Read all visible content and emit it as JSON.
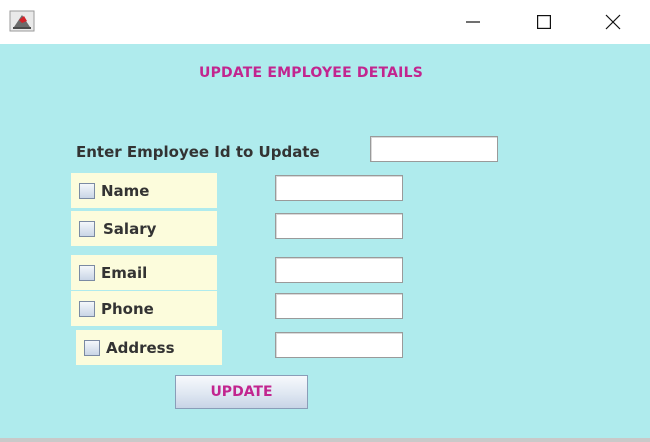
{
  "window": {
    "icon": "java-cup-icon",
    "controls": [
      "minimize-icon",
      "maximize-icon",
      "close-icon"
    ]
  },
  "form": {
    "heading": "UPDATE EMPLOYEE DETAILS",
    "employee_id_label": "Enter Employee Id to Update",
    "employee_id_value": "",
    "fields": [
      {
        "label": "Name",
        "checked": false,
        "value": ""
      },
      {
        "label": "Salary",
        "checked": false,
        "value": ""
      },
      {
        "label": "Email",
        "checked": false,
        "value": ""
      },
      {
        "label": "Phone",
        "checked": false,
        "value": ""
      },
      {
        "label": "Address",
        "checked": false,
        "value": ""
      }
    ],
    "submit_label": "UPDATE"
  },
  "colors": {
    "background": "#afebed",
    "accent_text": "#c2258f",
    "checkbox_panel": "#fcfcdc"
  }
}
